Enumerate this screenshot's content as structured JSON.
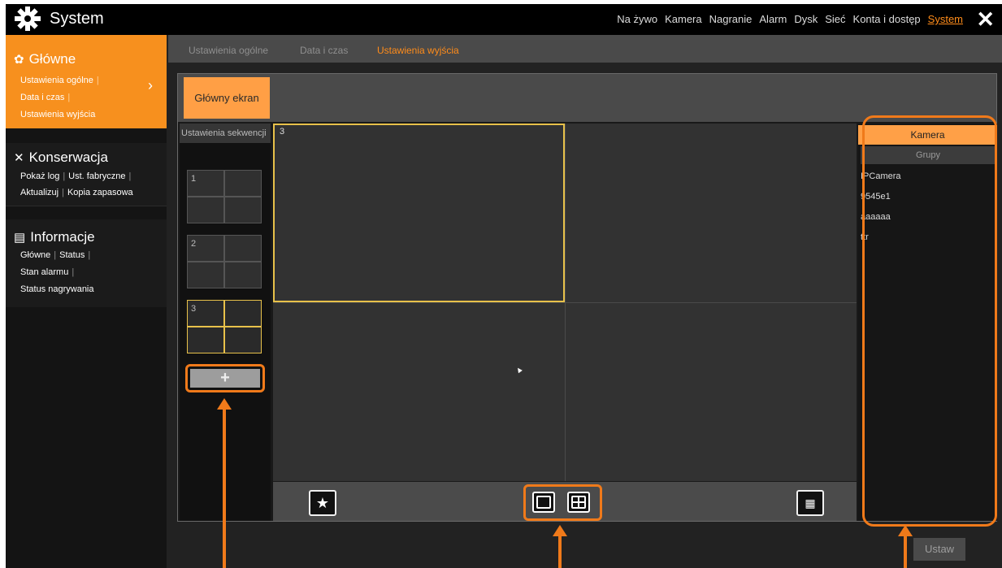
{
  "app": {
    "title": "System",
    "close_symbol": "✕",
    "icon": "gear-icon"
  },
  "topnav": {
    "items": [
      "Na żywo",
      "Kamera",
      "Nagranie",
      "Alarm",
      "Dysk",
      "Sieć",
      "Konta i dostęp",
      "System"
    ],
    "active": "System"
  },
  "sidebar": {
    "glowne": {
      "title": "Główne",
      "icon": "gear-small-icon",
      "items": [
        "Ustawienia ogólne",
        "Data i czas",
        "Ustawienia wyjścia"
      ]
    },
    "konserwacja": {
      "title": "Konserwacja",
      "icon": "tools-icon",
      "items": [
        "Pokaż log",
        "Ust. fabryczne",
        "Aktualizuj",
        "Kopia zapasowa"
      ]
    },
    "informacje": {
      "title": "Informacje",
      "icon": "monitor-icon",
      "items": [
        "Główne",
        "Status",
        "Stan alarmu",
        "Status nagrywania"
      ]
    },
    "separator": "|",
    "chevron": "›"
  },
  "subtabs": {
    "items": [
      "Ustawienia ogólne",
      "Data i czas",
      "Ustawienia wyjścia"
    ],
    "active": "Ustawienia wyjścia"
  },
  "main": {
    "tab_label": "Główny ekran",
    "sequence_header": "Ustawienia sekwencji",
    "sequences": [
      "1",
      "2",
      "3"
    ],
    "active_sequence": "3",
    "add_symbol": "+",
    "preview_selected_label": "3"
  },
  "right_panel": {
    "tabs": [
      "Kamera",
      "Grupy"
    ],
    "active_tab": "Kamera",
    "cameras": [
      "IPCamera",
      "9545e1",
      "aaaaaa",
      "ttr"
    ]
  },
  "buttons": {
    "set": "Ustaw"
  },
  "colors": {
    "accent": "#f7901e",
    "highlight": "#f07a1a",
    "selection": "#e8c14a"
  }
}
